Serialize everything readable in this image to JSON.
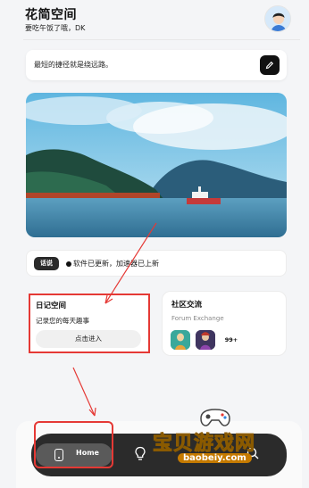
{
  "header": {
    "title": "花简空间",
    "subtitle": "要吃午饭了哦，DK",
    "avatar_icon": "user-avatar-icon"
  },
  "quote": {
    "text": "最短的捷径就是绕远路。",
    "edit_icon": "pencil-icon"
  },
  "hero": {
    "image": "lake-landscape-illustration"
  },
  "notice": {
    "badge": "话说",
    "text": "软件已更新，加速器已上新"
  },
  "diary": {
    "title": "日记空间",
    "description": "记录您的每天趣事",
    "button_label": "点击进入"
  },
  "community": {
    "title": "社区交流",
    "subtitle": "Forum Exchange",
    "more_count": "99+"
  },
  "nav": {
    "home_label": "Home",
    "home_icon": "phone-icon",
    "second_icon": "lightbulb-icon",
    "third_icon": "search-icon"
  },
  "watermark": {
    "main": "宝贝游戏网",
    "url": "baobeiy.com"
  },
  "colors": {
    "annotation_red": "#e53935",
    "nav_bg": "#2b2b2b",
    "background": "#f4f5f7"
  }
}
